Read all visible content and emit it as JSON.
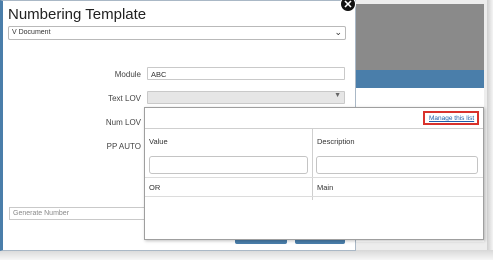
{
  "dialog": {
    "title": "Numbering Template",
    "template_select": {
      "value": "V Document"
    }
  },
  "form": {
    "module_label": "Module",
    "module_value": "ABC",
    "text_lov_label": "Text LOV",
    "text_lov_value": "",
    "num_lov_label": "Num LOV",
    "pp_auto_label": "PP AUTO"
  },
  "generate": {
    "placeholder": "Generate Number"
  },
  "lov_popup": {
    "manage_link": "Manage this list",
    "columns": [
      "Value",
      "Description"
    ],
    "rows": [
      {
        "value": "OR",
        "description": "Main"
      }
    ]
  },
  "colors": {
    "accent": "#4a7eaa",
    "highlight_border": "#d9322c",
    "link": "#1f5ea8"
  }
}
